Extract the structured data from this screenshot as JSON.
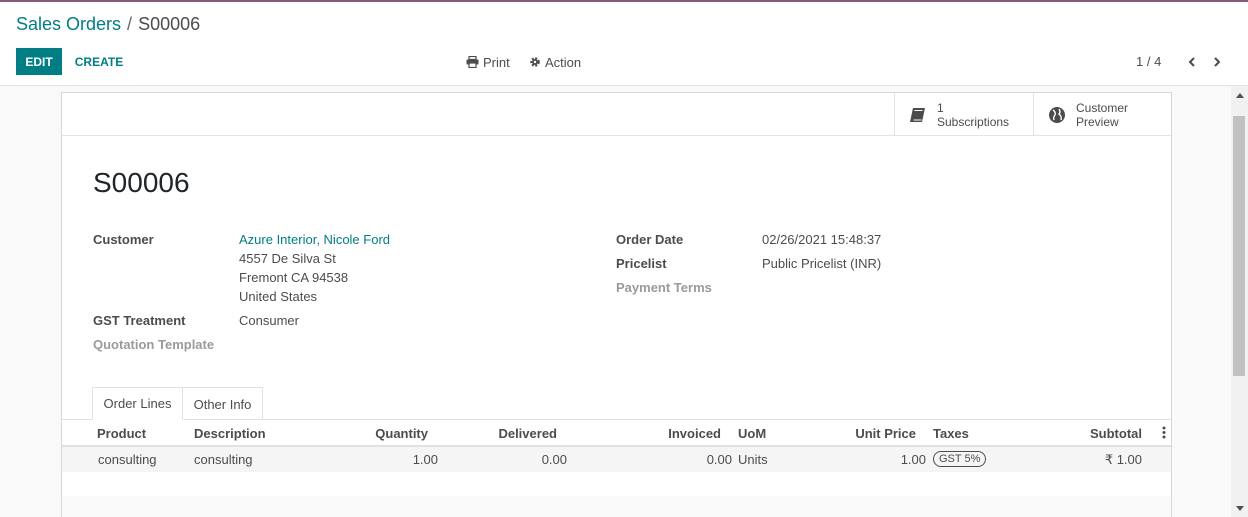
{
  "breadcrumb": {
    "parent": "Sales Orders",
    "separator": "/",
    "current": "S00006"
  },
  "toolbar": {
    "edit_label": "EDIT",
    "create_label": "CREATE",
    "print_label": "Print",
    "action_label": "Action"
  },
  "pager": {
    "value": "1 / 4"
  },
  "smart_buttons": {
    "subscriptions": {
      "count": "1",
      "label": "Subscriptions"
    },
    "preview": {
      "line1": "Customer",
      "line2": "Preview"
    }
  },
  "order": {
    "name": "S00006",
    "customer_label": "Customer",
    "customer_name": "Azure Interior, Nicole Ford",
    "address_line1": "4557 De Silva St",
    "address_line2": "Fremont CA 94538",
    "address_line3": "United States",
    "gst_label": "GST Treatment",
    "gst_value": "Consumer",
    "quotation_template_label": "Quotation Template",
    "order_date_label": "Order Date",
    "order_date_value": "02/26/2021 15:48:37",
    "pricelist_label": "Pricelist",
    "pricelist_value": "Public Pricelist (INR)",
    "payment_terms_label": "Payment Terms"
  },
  "tabs": [
    {
      "label": "Order Lines",
      "active": true
    },
    {
      "label": "Other Info",
      "active": false
    }
  ],
  "table": {
    "headers": {
      "product": "Product",
      "description": "Description",
      "quantity": "Quantity",
      "delivered": "Delivered",
      "invoiced": "Invoiced",
      "uom": "UoM",
      "unit_price": "Unit Price",
      "taxes": "Taxes",
      "subtotal": "Subtotal"
    },
    "rows": [
      {
        "product": "consulting",
        "description": "consulting",
        "quantity": "1.00",
        "delivered": "0.00",
        "invoiced": "0.00",
        "uom": "Units",
        "unit_price": "1.00",
        "taxes": "GST 5%",
        "subtotal": "₹ 1.00"
      }
    ]
  },
  "colors": {
    "accent": "#017e84",
    "brand": "#875a7b",
    "text": "#4c4c4c",
    "muted": "#9a9a9a"
  }
}
